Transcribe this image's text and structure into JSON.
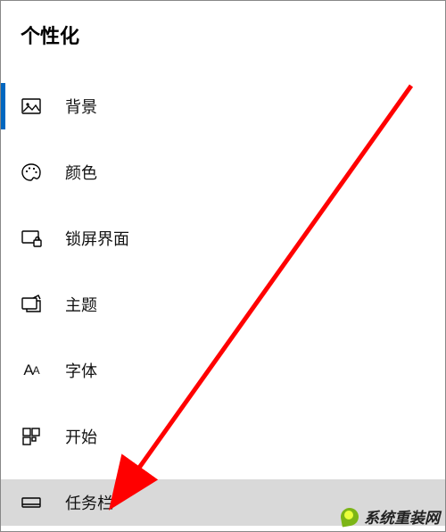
{
  "section_title": "个性化",
  "nav": {
    "items": [
      {
        "icon": "picture-icon",
        "label": "背景",
        "selected": true,
        "hover": false
      },
      {
        "icon": "palette-icon",
        "label": "颜色",
        "selected": false,
        "hover": false
      },
      {
        "icon": "lockscreen-icon",
        "label": "锁屏界面",
        "selected": false,
        "hover": false
      },
      {
        "icon": "themes-icon",
        "label": "主题",
        "selected": false,
        "hover": false
      },
      {
        "icon": "fonts-icon",
        "label": "字体",
        "selected": false,
        "hover": false
      },
      {
        "icon": "start-icon",
        "label": "开始",
        "selected": false,
        "hover": false
      },
      {
        "icon": "taskbar-icon",
        "label": "任务栏",
        "selected": false,
        "hover": true
      }
    ]
  },
  "watermark": "系统重装网",
  "annotation": {
    "color": "#ff0000",
    "target_index": 6
  }
}
